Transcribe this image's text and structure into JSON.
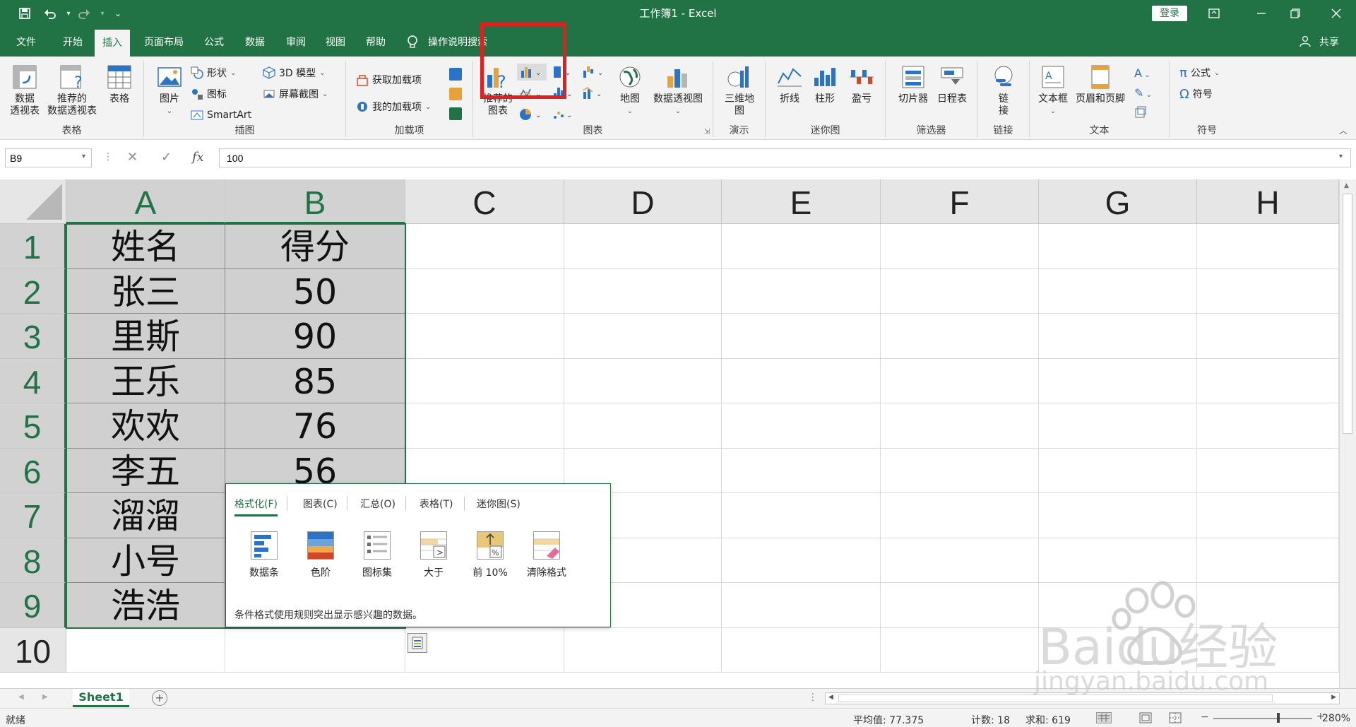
{
  "app": {
    "title": "工作簿1  -  Excel",
    "login_label": "登录",
    "share_label": "共享",
    "accent_color": "#217346",
    "qa_icons": [
      "save-icon",
      "undo-icon",
      "redo-icon",
      "customize-icon"
    ]
  },
  "tabs": [
    {
      "label": "文件",
      "active": false
    },
    {
      "label": "开始",
      "active": false
    },
    {
      "label": "插入",
      "active": true
    },
    {
      "label": "页面布局",
      "active": false
    },
    {
      "label": "公式",
      "active": false
    },
    {
      "label": "数据",
      "active": false
    },
    {
      "label": "审阅",
      "active": false
    },
    {
      "label": "视图",
      "active": false
    },
    {
      "label": "帮助",
      "active": false
    }
  ],
  "tell_me": "操作说明搜索",
  "ribbon": {
    "tables": {
      "group": "表格",
      "pivot": "数据\n透视表",
      "recommended": "推荐的\n数据透视表",
      "table": "表格"
    },
    "illustrations": {
      "group": "插图",
      "pictures": "图片",
      "shapes": "形状",
      "icons": "图标",
      "smartart": "SmartArt",
      "model3d": "3D 模型",
      "screenshot": "屏幕截图"
    },
    "addins": {
      "group": "加载项",
      "get": "获取加载项",
      "mine": "我的加载项"
    },
    "charts": {
      "group": "图表",
      "recommended": "推荐的\n图表",
      "maps": "地图",
      "pivotchart": "数据透视图"
    },
    "tours": {
      "group": "演示",
      "map3d": "三维地\n图"
    },
    "sparklines": {
      "group": "迷你图",
      "line": "折线",
      "column": "柱形",
      "winloss": "盈亏"
    },
    "filters": {
      "group": "筛选器",
      "slicer": "切片器",
      "timeline": "日程表"
    },
    "links": {
      "group": "链接",
      "link": "链\n接"
    },
    "text": {
      "group": "文本",
      "textbox": "文本框",
      "headerfooter": "页眉和页脚"
    },
    "symbols": {
      "group": "符号",
      "equation": "公式",
      "symbol": "符号"
    }
  },
  "formula_bar": {
    "name_box": "B9",
    "value": "100"
  },
  "columns": [
    "A",
    "B",
    "C",
    "D",
    "E",
    "F",
    "G",
    "H"
  ],
  "rows": [
    "1",
    "2",
    "3",
    "4",
    "5",
    "6",
    "7",
    "8",
    "9",
    "10"
  ],
  "cells": {
    "A": [
      "姓名",
      "张三",
      "里斯",
      "王乐",
      "欢欢",
      "李五",
      "溜溜",
      "小号",
      "浩浩",
      ""
    ],
    "B": [
      "得分",
      "50",
      "90",
      "85",
      "76",
      "56",
      "",
      "",
      "",
      ""
    ]
  },
  "quick_analysis": {
    "tabs": [
      "格式化(F)",
      "图表(C)",
      "汇总(O)",
      "表格(T)",
      "迷你图(S)"
    ],
    "items": [
      {
        "label": "数据条",
        "icon": "data-bars-icon"
      },
      {
        "label": "色阶",
        "icon": "color-scale-icon"
      },
      {
        "label": "图标集",
        "icon": "icon-set-icon"
      },
      {
        "label": "大于",
        "icon": "greater-than-icon"
      },
      {
        "label": "前 10%",
        "icon": "top-10-icon"
      },
      {
        "label": "清除格式",
        "icon": "clear-format-icon"
      }
    ],
    "description": "条件格式使用规则突出显示感兴趣的数据。"
  },
  "sheet": {
    "name": "Sheet1"
  },
  "status": {
    "ready": "就绪",
    "average": "平均值: 77.375",
    "count": "计数: 18",
    "sum": "求和: 619",
    "zoom": "280%"
  },
  "watermark": {
    "line1": "Baidu经验",
    "line2": "jingyan.baidu.com"
  }
}
